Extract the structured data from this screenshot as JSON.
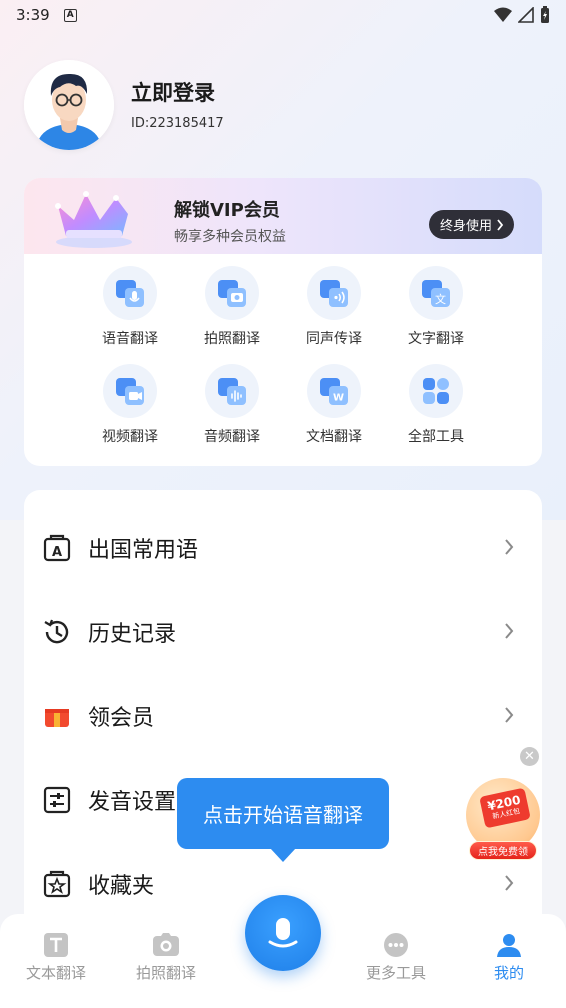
{
  "status_bar": {
    "time": "3:39",
    "badge": "A"
  },
  "profile": {
    "title": "立即登录",
    "id_text": "ID:223185417"
  },
  "vip": {
    "title": "解锁VIP会员",
    "subtitle": "畅享多种会员权益",
    "button_label": "终身使用"
  },
  "tools": [
    {
      "label": "语音翻译",
      "icon": "voice-translate-icon"
    },
    {
      "label": "拍照翻译",
      "icon": "photo-translate-icon"
    },
    {
      "label": "同声传译",
      "icon": "simultaneous-interpret-icon"
    },
    {
      "label": "文字翻译",
      "icon": "text-translate-icon"
    },
    {
      "label": "视频翻译",
      "icon": "video-translate-icon"
    },
    {
      "label": "音频翻译",
      "icon": "audio-translate-icon"
    },
    {
      "label": "文档翻译",
      "icon": "document-translate-icon"
    },
    {
      "label": "全部工具",
      "icon": "all-tools-icon"
    }
  ],
  "menu": [
    {
      "label": "出国常用语",
      "icon": "phrasebook-icon"
    },
    {
      "label": "历史记录",
      "icon": "history-icon"
    },
    {
      "label": "领会员",
      "icon": "gift-icon"
    },
    {
      "label": "发音设置",
      "icon": "settings-sliders-icon"
    },
    {
      "label": "收藏夹",
      "icon": "favorites-icon"
    }
  ],
  "tooltip": "点击开始语音翻译",
  "promo": {
    "amount": "¥200",
    "tag": "新人红包",
    "button": "点我免费领"
  },
  "bottom_nav": [
    {
      "label": "文本翻译",
      "icon": "text-tab-icon",
      "active": false
    },
    {
      "label": "拍照翻译",
      "icon": "camera-tab-icon",
      "active": false
    },
    {
      "label": "更多工具",
      "icon": "more-tools-tab-icon",
      "active": false
    },
    {
      "label": "我的",
      "icon": "profile-tab-icon",
      "active": true
    }
  ],
  "colors": {
    "accent": "#2d8cf0",
    "vip_button": "#2f2f38",
    "promo_red": "#ee3b2e"
  }
}
